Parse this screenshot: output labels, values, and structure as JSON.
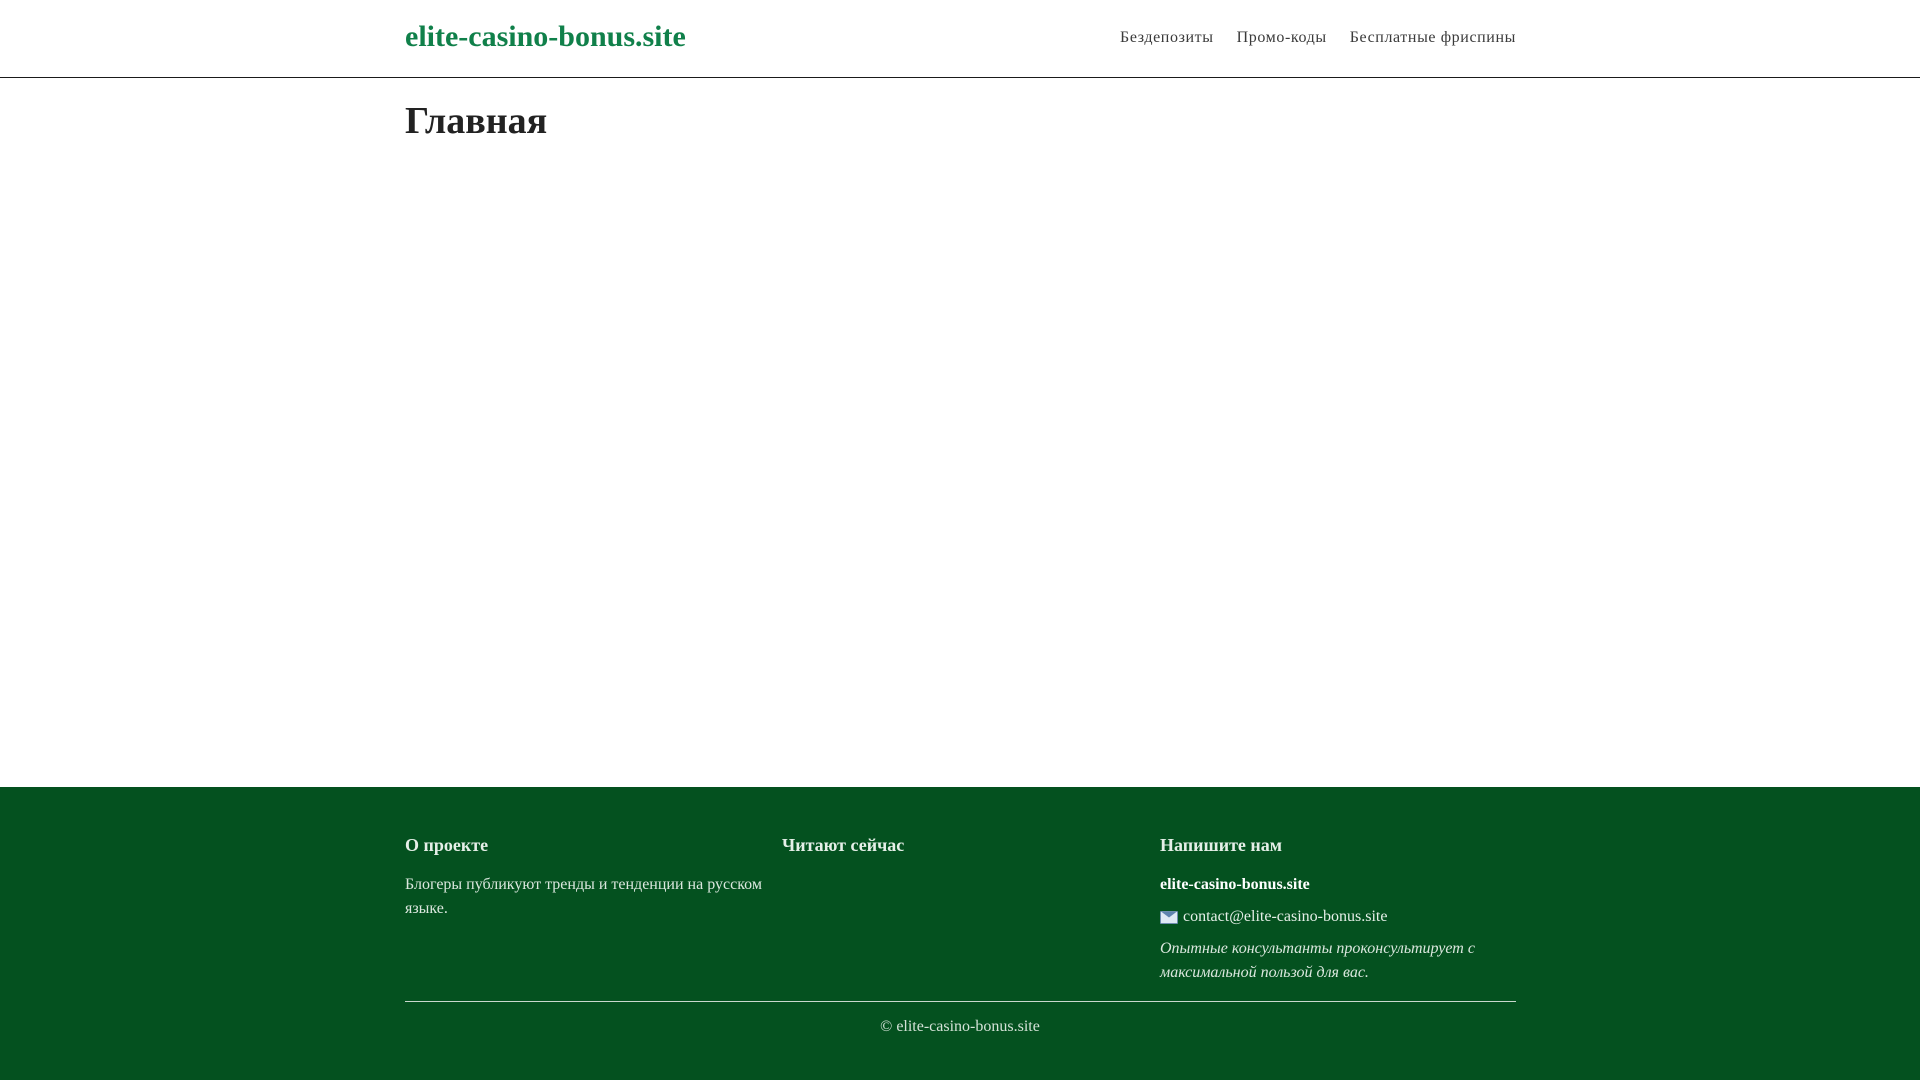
{
  "header": {
    "site_title": "elite-casino-bonus.site",
    "nav": [
      {
        "label": "Бездепозиты"
      },
      {
        "label": "Промо-коды"
      },
      {
        "label": "Бесплатные фриспины"
      }
    ],
    "accent_color": "#10804a"
  },
  "main": {
    "page_title": "Главная"
  },
  "footer": {
    "background_color": "#04511f",
    "about": {
      "heading": "О проекте",
      "text": "Блогеры публикуют тренды и тенденции на русском языке."
    },
    "reading": {
      "heading": "Читают сейчас"
    },
    "contact": {
      "heading": "Напишите нам",
      "site": "elite-casino-bonus.site",
      "email_icon": "envelope-icon",
      "email": "contact@elite-casino-bonus.site",
      "note": "Опытные консультанты проконсультирует с максимальной пользой для вас."
    },
    "copyright": "© elite-casino-bonus.site"
  }
}
